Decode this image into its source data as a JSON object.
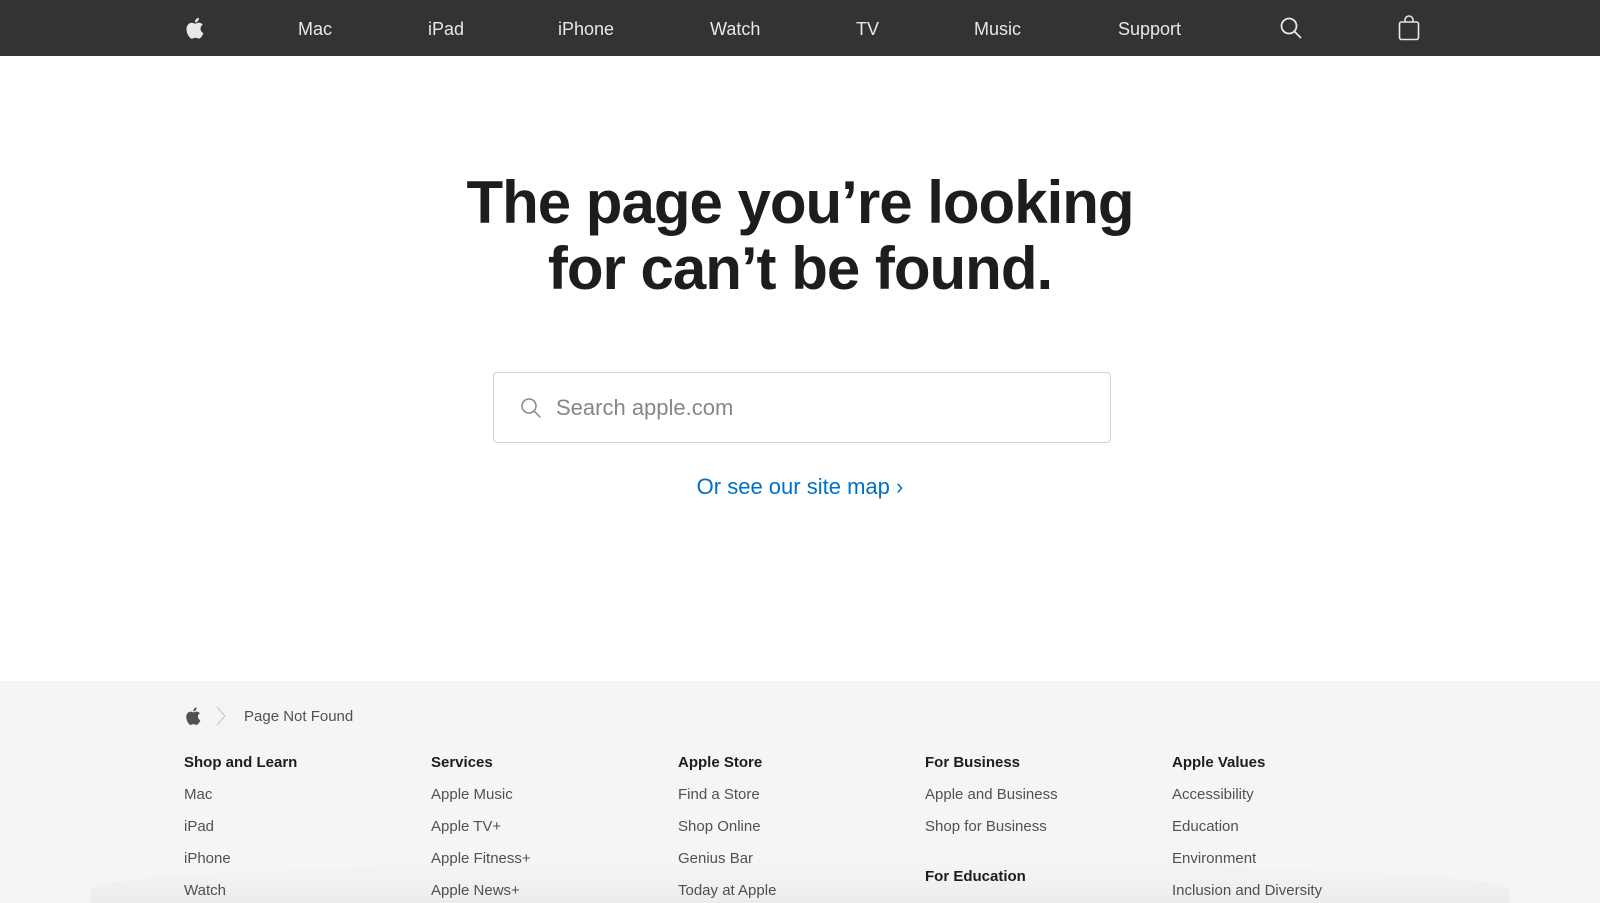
{
  "nav": {
    "apple_logo": "apple-logo-icon",
    "items": [
      {
        "label": "Mac"
      },
      {
        "label": "iPad"
      },
      {
        "label": "iPhone"
      },
      {
        "label": "Watch"
      },
      {
        "label": "TV"
      },
      {
        "label": "Music"
      },
      {
        "label": "Support"
      }
    ],
    "search_icon": "search-icon",
    "bag_icon": "shopping-bag-icon",
    "background": "#333333"
  },
  "hero": {
    "title_line1": "The page you’re looking",
    "title_line2": "for can’t be found."
  },
  "search": {
    "placeholder": "Search apple.com",
    "value": ""
  },
  "sitemap_link": {
    "label": "Or see our site map ›",
    "color": "#0070c9"
  },
  "footer": {
    "breadcrumb": {
      "home_icon": "apple-logo-icon",
      "current": "Page Not Found"
    },
    "columns": [
      {
        "title": "Shop and Learn",
        "links": [
          "Mac",
          "iPad",
          "iPhone",
          "Watch"
        ]
      },
      {
        "title": "Services",
        "links": [
          "Apple Music",
          "Apple TV+",
          "Apple Fitness+",
          "Apple News+"
        ]
      },
      {
        "title": "Apple Store",
        "links": [
          "Find a Store",
          "Shop Online",
          "Genius Bar",
          "Today at Apple"
        ]
      },
      {
        "title": "For Business",
        "links": [
          "Apple and Business",
          "Shop for Business"
        ],
        "subsection_title": "For Education"
      },
      {
        "title": "Apple Values",
        "links": [
          "Accessibility",
          "Education",
          "Environment",
          "Inclusion and Diversity"
        ]
      }
    ]
  }
}
